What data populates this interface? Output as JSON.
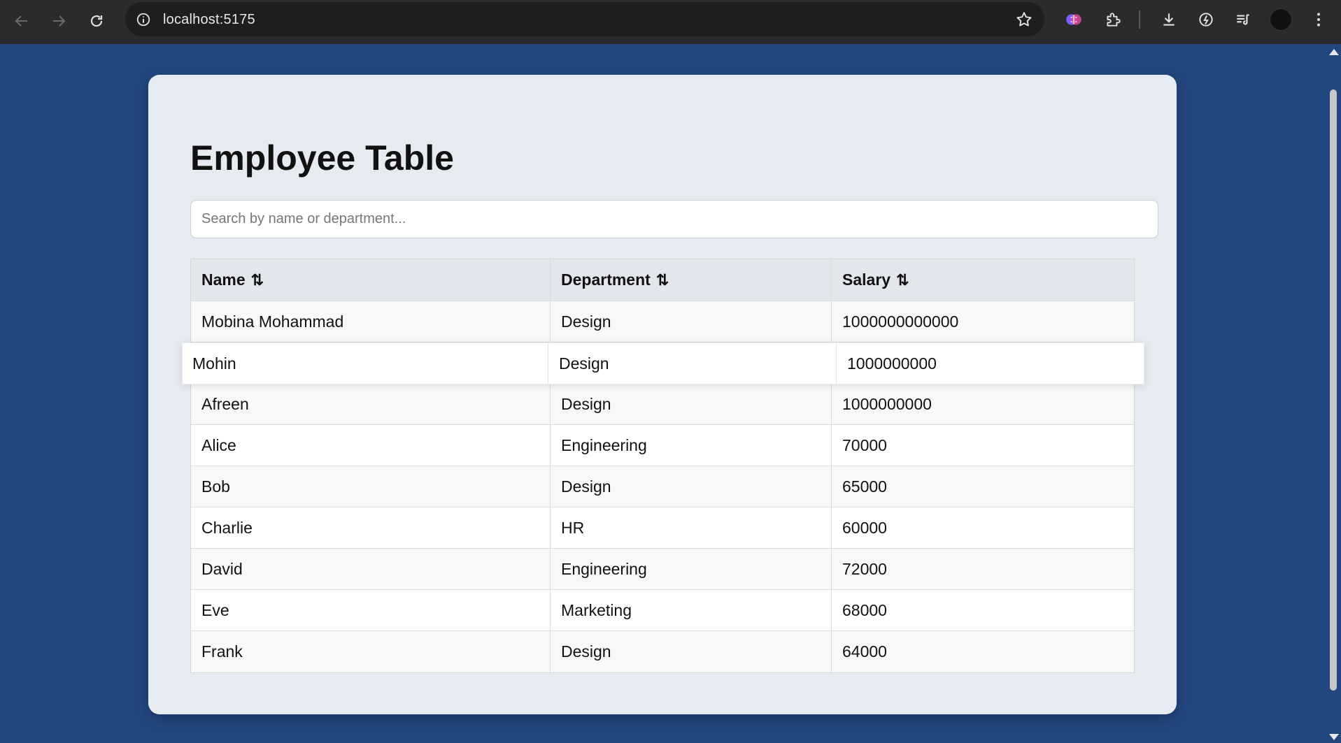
{
  "browser": {
    "url": "localhost:5175"
  },
  "page": {
    "title": "Employee Table",
    "search_placeholder": "Search by name or department..."
  },
  "table": {
    "columns": [
      {
        "label": "Name",
        "sort_icon": "⇅"
      },
      {
        "label": "Department",
        "sort_icon": "⇅"
      },
      {
        "label": "Salary",
        "sort_icon": "⇅"
      }
    ],
    "rows": [
      {
        "name": "Mobina Mohammad",
        "department": "Design",
        "salary": "1000000000000"
      },
      {
        "name": "Afreen",
        "department": "Design",
        "salary": "1000000000"
      },
      {
        "name": "Alice",
        "department": "Engineering",
        "salary": "70000"
      },
      {
        "name": "Bob",
        "department": "Design",
        "salary": "65000"
      },
      {
        "name": "Charlie",
        "department": "HR",
        "salary": "60000"
      },
      {
        "name": "David",
        "department": "Engineering",
        "salary": "72000"
      },
      {
        "name": "Eve",
        "department": "Marketing",
        "salary": "68000"
      },
      {
        "name": "Frank",
        "department": "Design",
        "salary": "64000"
      }
    ],
    "dragging_row": {
      "name": "Mohin",
      "department": "Design",
      "salary": "1000000000"
    }
  }
}
